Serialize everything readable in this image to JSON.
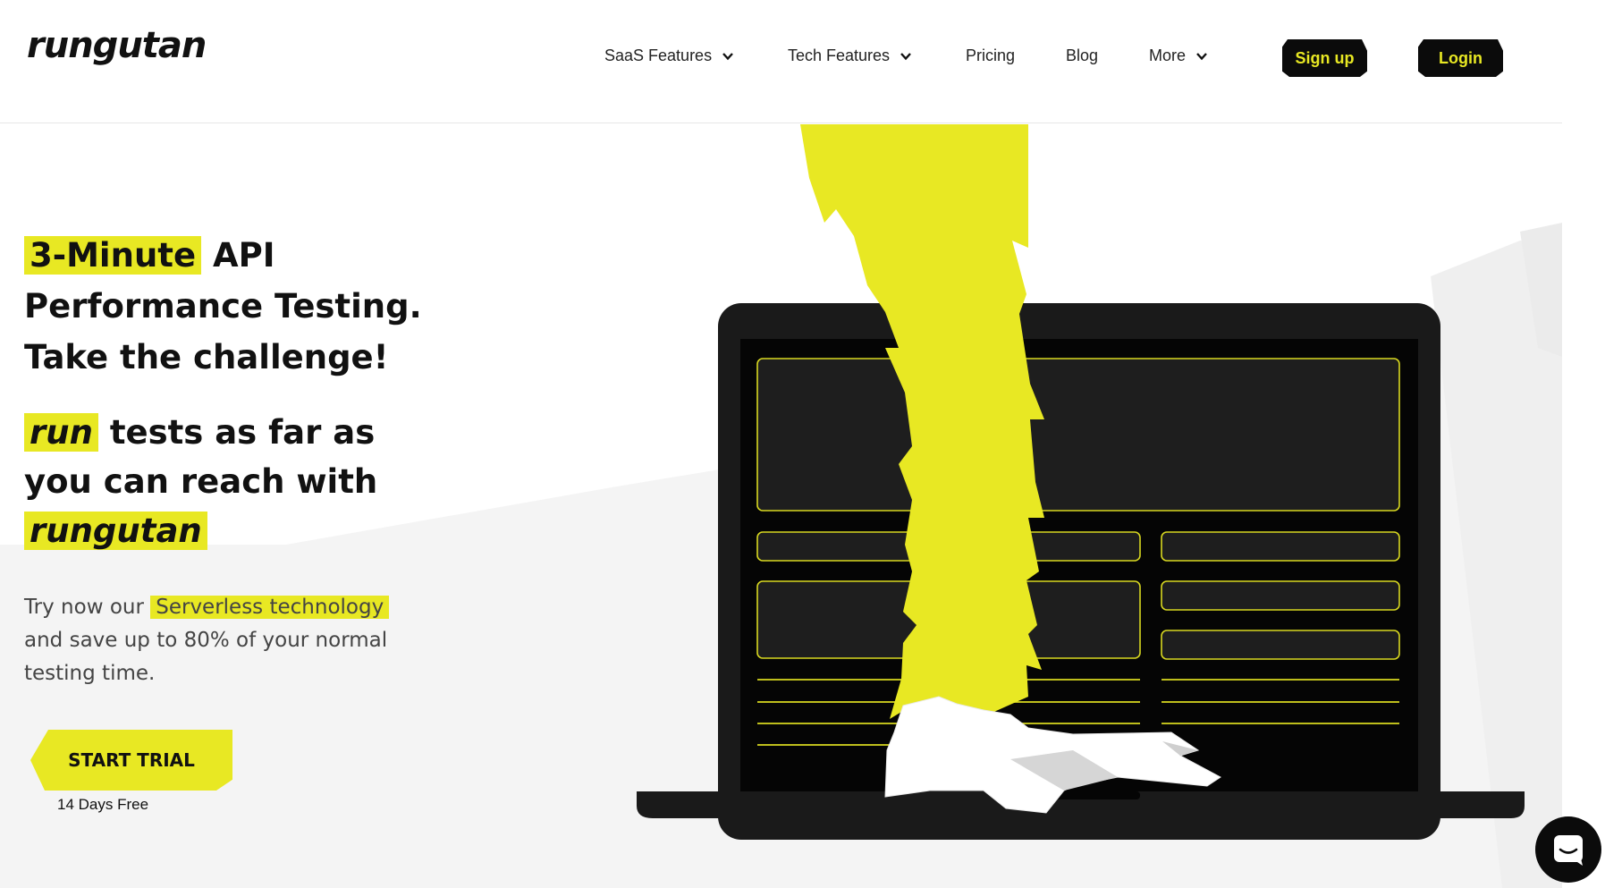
{
  "brand": {
    "logo_text": "rungutan"
  },
  "nav": {
    "saas_features": "SaaS Features",
    "tech_features": "Tech Features",
    "pricing": "Pricing",
    "blog": "Blog",
    "more": "More",
    "signup": "Sign up",
    "login": "Login"
  },
  "hero": {
    "headline_highlight": "3-Minute",
    "headline_rest_1": " API",
    "headline_line_2": "Performance Testing.",
    "headline_line_3": "Take the challenge!",
    "sub_highlight_1": "run",
    "sub_text_1": " tests as far as",
    "sub_text_2": "you can reach with",
    "sub_highlight_2": "rungutan",
    "desc_prefix": "Try now our ",
    "desc_highlight": "Serverless technology",
    "desc_rest": " and save up to 80% of your normal testing time.",
    "cta": "START TRIAL",
    "cta_note": "14 Days Free"
  },
  "colors": {
    "accent": "#e8e823",
    "dark": "#0b0b0b",
    "laptop": "#1a1a1a"
  },
  "icons": {
    "chevron": "chevron-down-icon",
    "chat": "chat-icon"
  }
}
